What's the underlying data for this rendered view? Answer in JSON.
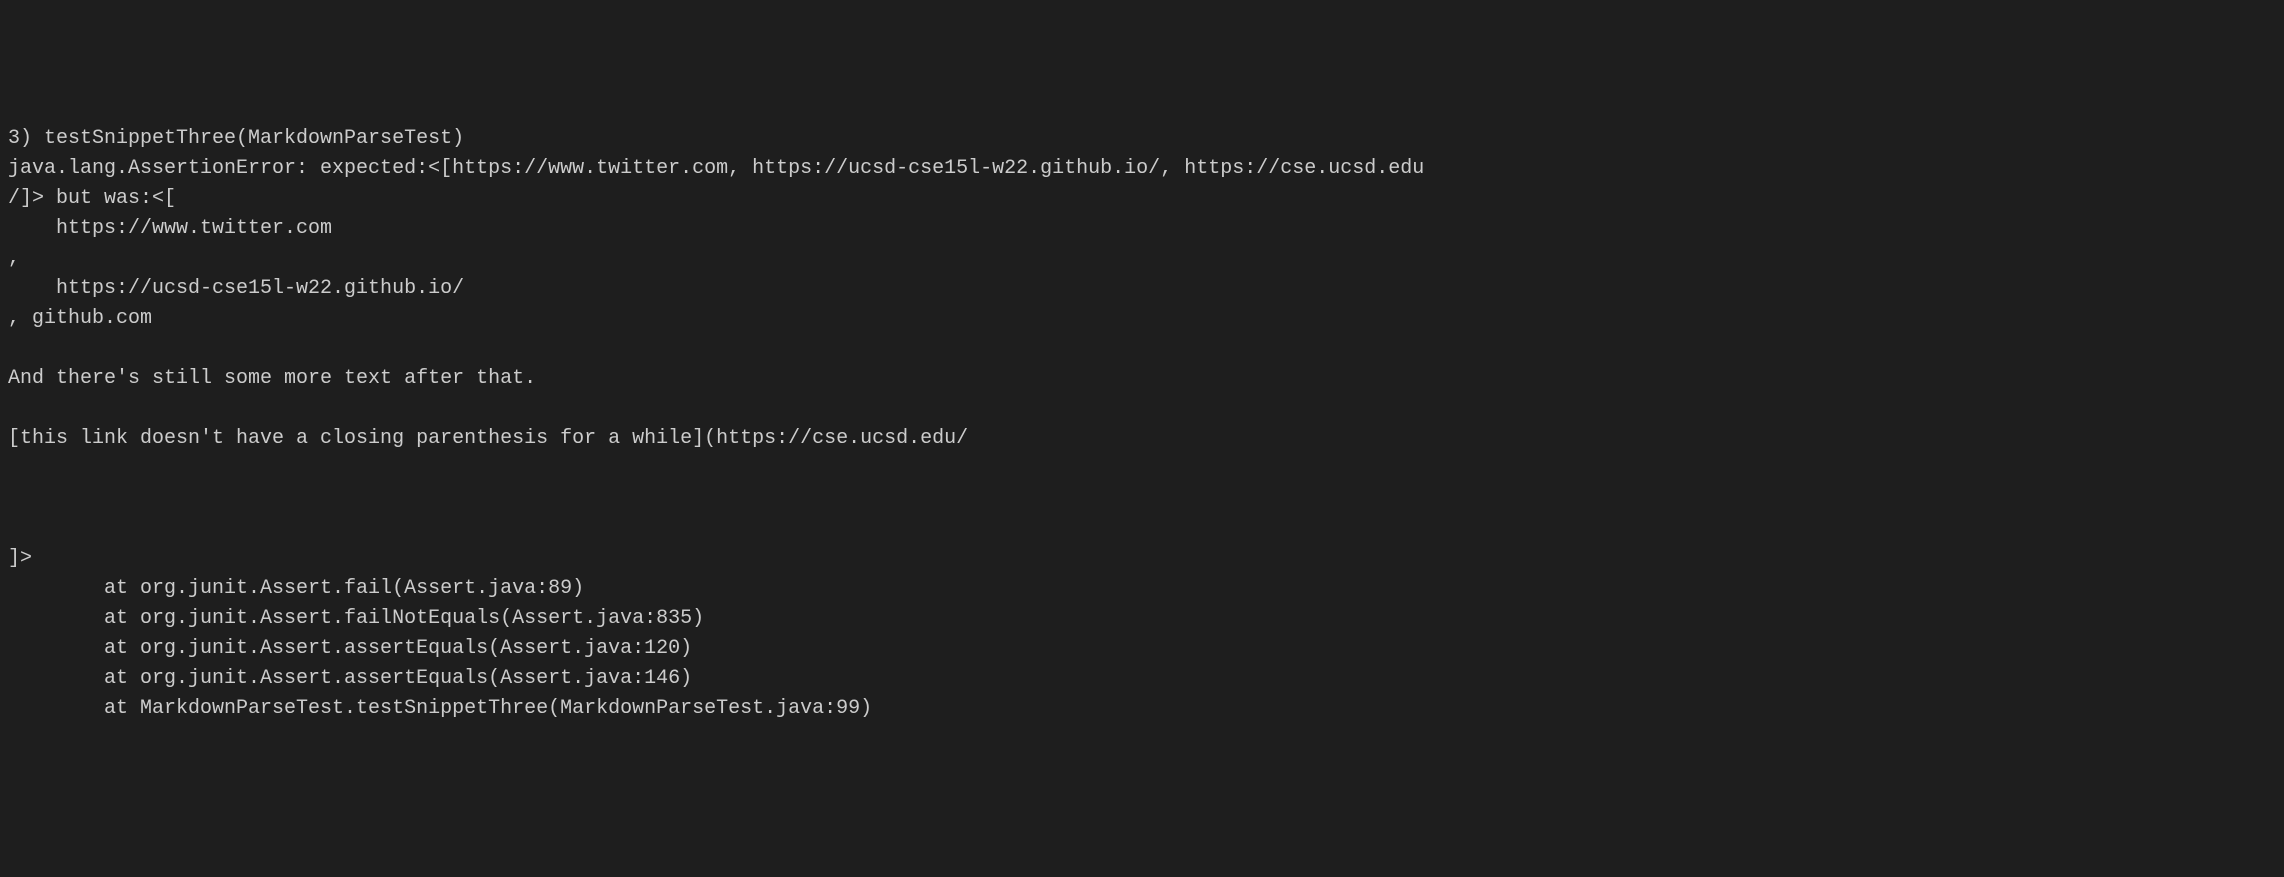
{
  "terminal": {
    "lines": [
      "3) testSnippetThree(MarkdownParseTest)",
      "java.lang.AssertionError: expected:<[https://www.twitter.com, https://ucsd-cse15l-w22.github.io/, https://cse.ucsd.edu",
      "/]> but was:<[",
      "    https://www.twitter.com",
      ", ",
      "    https://ucsd-cse15l-w22.github.io/",
      ", github.com",
      "",
      "And there's still some more text after that.",
      "",
      "[this link doesn't have a closing parenthesis for a while](https://cse.ucsd.edu/",
      "",
      "",
      "",
      "]>",
      "        at org.junit.Assert.fail(Assert.java:89)",
      "        at org.junit.Assert.failNotEquals(Assert.java:835)",
      "        at org.junit.Assert.assertEquals(Assert.java:120)",
      "        at org.junit.Assert.assertEquals(Assert.java:146)",
      "        at MarkdownParseTest.testSnippetThree(MarkdownParseTest.java:99)"
    ]
  }
}
